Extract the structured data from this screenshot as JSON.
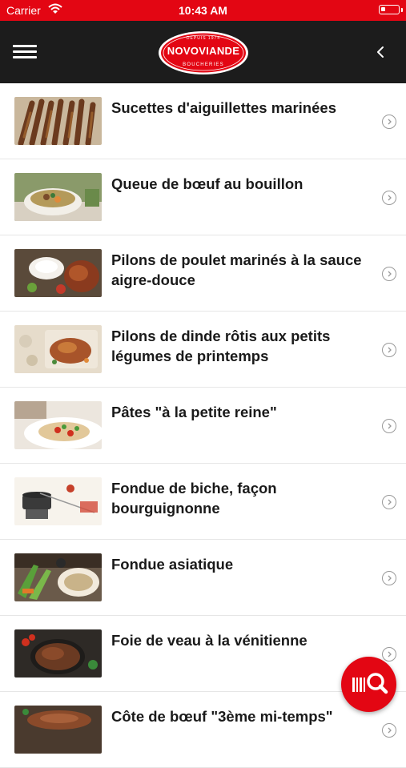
{
  "status_bar": {
    "carrier": "Carrier",
    "time": "10:43 AM"
  },
  "header": {
    "logo": {
      "brand": "NOVOVIANDE",
      "tagline_top": "DEPUIS 1974",
      "tagline_bottom": "BOUCHERIES"
    },
    "menu_icon": "hamburger-icon",
    "back_icon": "chevron-left-icon"
  },
  "recipes": [
    {
      "title": "Sucettes d'aiguillettes marinées",
      "thumb": "skewers-photo"
    },
    {
      "title": "Queue de bœuf au bouillon",
      "thumb": "soup-photo"
    },
    {
      "title": "Pilons de poulet marinés à la sauce aigre-douce",
      "thumb": "chicken-photo"
    },
    {
      "title": "Pilons de dinde rôtis aux petits légumes de printemps",
      "thumb": "turkey-photo"
    },
    {
      "title": "Pâtes \"à la petite reine\"",
      "thumb": "pasta-photo"
    },
    {
      "title": "Fondue de biche, façon bourguignonne",
      "thumb": "fondue-photo"
    },
    {
      "title": "Fondue asiatique",
      "thumb": "asian-fondue-photo"
    },
    {
      "title": "Foie de veau à la vénitienne",
      "thumb": "liver-photo"
    },
    {
      "title": "Côte de bœuf \"3ème mi-temps\"",
      "thumb": "steak-photo"
    }
  ],
  "fab": {
    "icon": "barcode-search-icon"
  },
  "colors": {
    "brand_red": "#e30613",
    "navbar": "#1c1c1c"
  }
}
